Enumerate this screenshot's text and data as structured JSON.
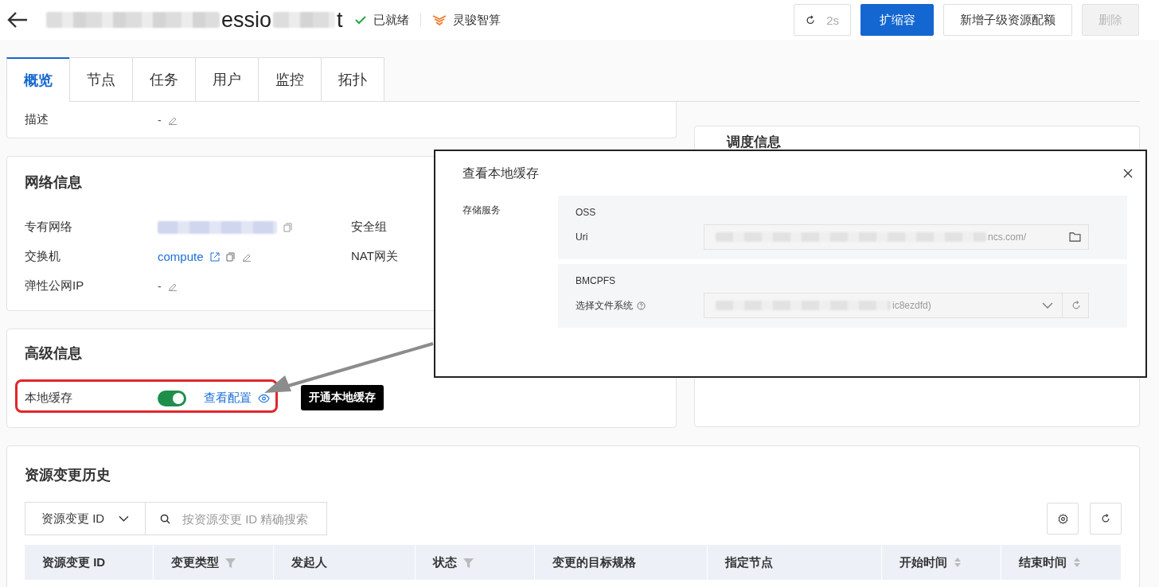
{
  "header": {
    "title_parts": [
      "essio",
      "t"
    ],
    "status": "已就绪",
    "product": "灵骏智算",
    "refresh": "2s",
    "buttons": [
      {
        "label": "扩缩容",
        "kind": "primary",
        "disabled": false
      },
      {
        "label": "新增子级资源配额",
        "kind": "default",
        "disabled": false
      },
      {
        "label": "删除",
        "kind": "default",
        "disabled": true
      }
    ]
  },
  "tabs": [
    {
      "label": "概览",
      "selected": true
    },
    {
      "label": "节点",
      "selected": false
    },
    {
      "label": "任务",
      "selected": false
    },
    {
      "label": "用户",
      "selected": false
    },
    {
      "label": "监控",
      "selected": false
    },
    {
      "label": "拓扑",
      "selected": false
    }
  ],
  "basic": {
    "fields": [
      {
        "label": "描述",
        "value": "-"
      }
    ]
  },
  "network": {
    "title": "网络信息",
    "fields": [
      {
        "label": "专有网络",
        "kind": "redacted"
      },
      {
        "label": "交换机",
        "kind": "link",
        "value": "compute"
      },
      {
        "label": "弹性公网IP",
        "kind": "text",
        "value": "-"
      }
    ],
    "right_fields": [
      {
        "label": "安全组"
      },
      {
        "label": "NAT网关"
      }
    ]
  },
  "advanced": {
    "title": "高级信息",
    "fields": [
      {
        "label": "本地缓存",
        "on": true,
        "link": "查看配置"
      }
    ]
  },
  "schedule": {
    "title": "调度信息"
  },
  "history": {
    "title": "资源变更历史",
    "filter": "资源变更 ID",
    "search_placeholder": "按资源变更 ID 精确搜索",
    "columns": [
      {
        "label": "资源变更 ID",
        "kind": "plain"
      },
      {
        "label": "变更类型",
        "kind": "filter"
      },
      {
        "label": "发起人",
        "kind": "plain"
      },
      {
        "label": "状态",
        "kind": "filter"
      },
      {
        "label": "变更的目标规格",
        "kind": "plain"
      },
      {
        "label": "指定节点",
        "kind": "plain"
      },
      {
        "label": "开始时间",
        "kind": "sort"
      },
      {
        "label": "结束时间",
        "kind": "sort"
      }
    ]
  },
  "modal": {
    "title": "查看本地缓存",
    "section": "存储服务",
    "groups": [
      {
        "name": "OSS",
        "field_label": "Uri",
        "value": "ncs.com/",
        "kind": "path",
        "help": false
      },
      {
        "name": "BMCPFS",
        "field_label": "选择文件系统",
        "value": "ic8ezdfd)",
        "kind": "select",
        "help": true
      }
    ]
  },
  "annotation": {
    "callout": "开通本地缓存"
  }
}
